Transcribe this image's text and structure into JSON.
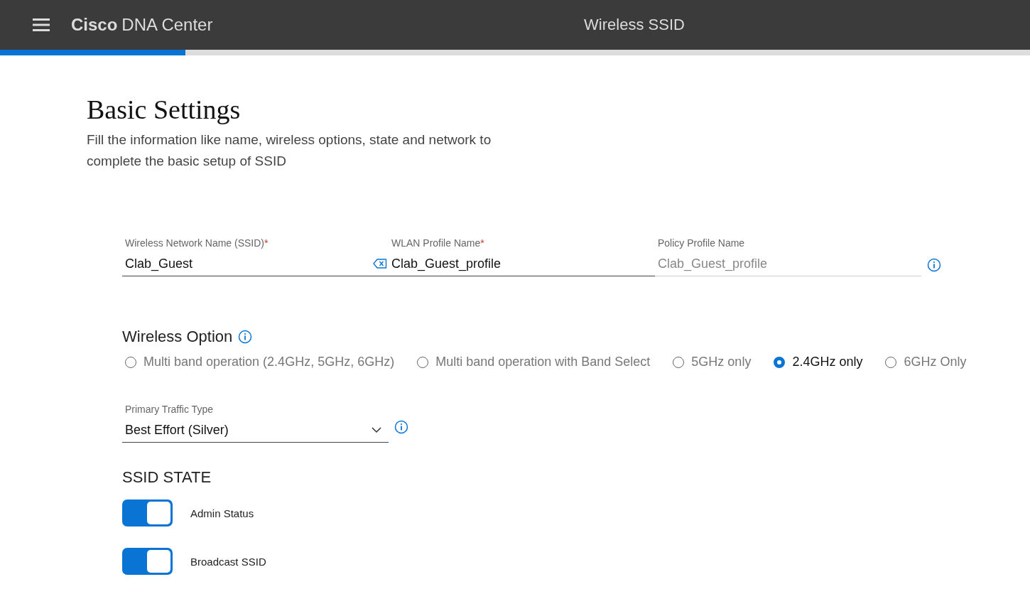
{
  "header": {
    "brand_bold": "Cisco",
    "brand": "DNA Center",
    "title": "Wireless SSID"
  },
  "progress": {
    "level": 0.18
  },
  "section": {
    "title": "Basic Settings",
    "description": "Fill the information like name, wireless options, state and network to complete the basic setup of SSID"
  },
  "fields": [
    {
      "label": "Wireless Network Name (SSID)",
      "required_mark": "*",
      "value": "Clab_Guest",
      "disabled": false,
      "clearable": true,
      "info": false
    },
    {
      "label": "WLAN Profile Name",
      "required_mark": "*",
      "value": "Clab_Guest_profile",
      "disabled": false,
      "clearable": false,
      "info": false
    },
    {
      "label": "Policy Profile Name",
      "value": "Clab_Guest_profile",
      "disabled": true,
      "clearable": false,
      "info": true
    }
  ],
  "wireless_option": {
    "title": "Wireless Option",
    "options": [
      {
        "label": "Multi band operation (2.4GHz, 5GHz, 6GHz)",
        "selected": false
      },
      {
        "label": "Multi band operation with Band Select",
        "selected": false
      },
      {
        "label": "5GHz only",
        "selected": false
      },
      {
        "label": "2.4GHz only",
        "selected": true
      },
      {
        "label": "6GHz Only",
        "selected": false
      }
    ]
  },
  "primary_traffic_type": {
    "label": "Primary Traffic Type",
    "value": "Best Effort (Silver)"
  },
  "ssid_state": {
    "title": "SSID STATE",
    "toggles": [
      {
        "label": "Admin Status",
        "on": true
      },
      {
        "label": "Broadcast SSID",
        "on": true
      }
    ]
  }
}
